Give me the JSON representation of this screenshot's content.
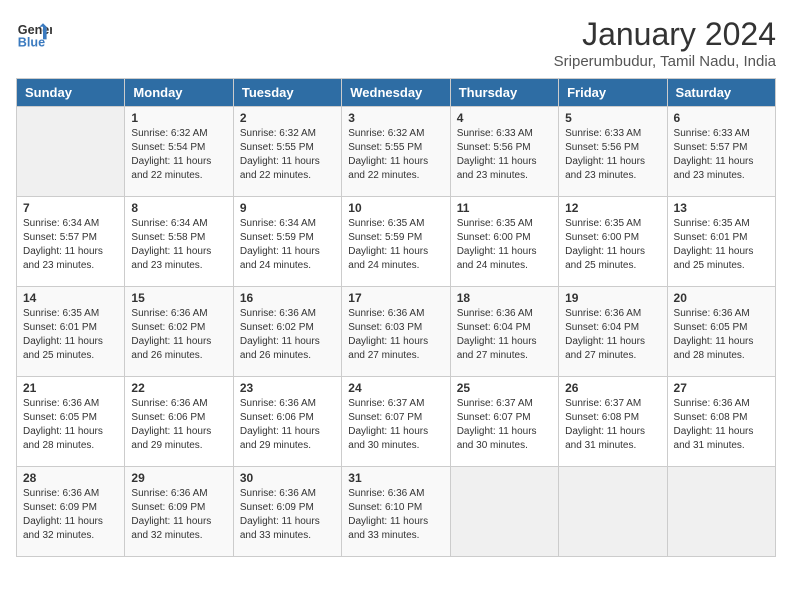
{
  "header": {
    "logo_line1": "General",
    "logo_line2": "Blue",
    "title": "January 2024",
    "subtitle": "Sriperumbudur, Tamil Nadu, India"
  },
  "days_of_week": [
    "Sunday",
    "Monday",
    "Tuesday",
    "Wednesday",
    "Thursday",
    "Friday",
    "Saturday"
  ],
  "weeks": [
    [
      {
        "day": "",
        "info": ""
      },
      {
        "day": "1",
        "info": "Sunrise: 6:32 AM\nSunset: 5:54 PM\nDaylight: 11 hours\nand 22 minutes."
      },
      {
        "day": "2",
        "info": "Sunrise: 6:32 AM\nSunset: 5:55 PM\nDaylight: 11 hours\nand 22 minutes."
      },
      {
        "day": "3",
        "info": "Sunrise: 6:32 AM\nSunset: 5:55 PM\nDaylight: 11 hours\nand 22 minutes."
      },
      {
        "day": "4",
        "info": "Sunrise: 6:33 AM\nSunset: 5:56 PM\nDaylight: 11 hours\nand 23 minutes."
      },
      {
        "day": "5",
        "info": "Sunrise: 6:33 AM\nSunset: 5:56 PM\nDaylight: 11 hours\nand 23 minutes."
      },
      {
        "day": "6",
        "info": "Sunrise: 6:33 AM\nSunset: 5:57 PM\nDaylight: 11 hours\nand 23 minutes."
      }
    ],
    [
      {
        "day": "7",
        "info": "Sunrise: 6:34 AM\nSunset: 5:57 PM\nDaylight: 11 hours\nand 23 minutes."
      },
      {
        "day": "8",
        "info": "Sunrise: 6:34 AM\nSunset: 5:58 PM\nDaylight: 11 hours\nand 23 minutes."
      },
      {
        "day": "9",
        "info": "Sunrise: 6:34 AM\nSunset: 5:59 PM\nDaylight: 11 hours\nand 24 minutes."
      },
      {
        "day": "10",
        "info": "Sunrise: 6:35 AM\nSunset: 5:59 PM\nDaylight: 11 hours\nand 24 minutes."
      },
      {
        "day": "11",
        "info": "Sunrise: 6:35 AM\nSunset: 6:00 PM\nDaylight: 11 hours\nand 24 minutes."
      },
      {
        "day": "12",
        "info": "Sunrise: 6:35 AM\nSunset: 6:00 PM\nDaylight: 11 hours\nand 25 minutes."
      },
      {
        "day": "13",
        "info": "Sunrise: 6:35 AM\nSunset: 6:01 PM\nDaylight: 11 hours\nand 25 minutes."
      }
    ],
    [
      {
        "day": "14",
        "info": "Sunrise: 6:35 AM\nSunset: 6:01 PM\nDaylight: 11 hours\nand 25 minutes."
      },
      {
        "day": "15",
        "info": "Sunrise: 6:36 AM\nSunset: 6:02 PM\nDaylight: 11 hours\nand 26 minutes."
      },
      {
        "day": "16",
        "info": "Sunrise: 6:36 AM\nSunset: 6:02 PM\nDaylight: 11 hours\nand 26 minutes."
      },
      {
        "day": "17",
        "info": "Sunrise: 6:36 AM\nSunset: 6:03 PM\nDaylight: 11 hours\nand 27 minutes."
      },
      {
        "day": "18",
        "info": "Sunrise: 6:36 AM\nSunset: 6:04 PM\nDaylight: 11 hours\nand 27 minutes."
      },
      {
        "day": "19",
        "info": "Sunrise: 6:36 AM\nSunset: 6:04 PM\nDaylight: 11 hours\nand 27 minutes."
      },
      {
        "day": "20",
        "info": "Sunrise: 6:36 AM\nSunset: 6:05 PM\nDaylight: 11 hours\nand 28 minutes."
      }
    ],
    [
      {
        "day": "21",
        "info": "Sunrise: 6:36 AM\nSunset: 6:05 PM\nDaylight: 11 hours\nand 28 minutes."
      },
      {
        "day": "22",
        "info": "Sunrise: 6:36 AM\nSunset: 6:06 PM\nDaylight: 11 hours\nand 29 minutes."
      },
      {
        "day": "23",
        "info": "Sunrise: 6:36 AM\nSunset: 6:06 PM\nDaylight: 11 hours\nand 29 minutes."
      },
      {
        "day": "24",
        "info": "Sunrise: 6:37 AM\nSunset: 6:07 PM\nDaylight: 11 hours\nand 30 minutes."
      },
      {
        "day": "25",
        "info": "Sunrise: 6:37 AM\nSunset: 6:07 PM\nDaylight: 11 hours\nand 30 minutes."
      },
      {
        "day": "26",
        "info": "Sunrise: 6:37 AM\nSunset: 6:08 PM\nDaylight: 11 hours\nand 31 minutes."
      },
      {
        "day": "27",
        "info": "Sunrise: 6:36 AM\nSunset: 6:08 PM\nDaylight: 11 hours\nand 31 minutes."
      }
    ],
    [
      {
        "day": "28",
        "info": "Sunrise: 6:36 AM\nSunset: 6:09 PM\nDaylight: 11 hours\nand 32 minutes."
      },
      {
        "day": "29",
        "info": "Sunrise: 6:36 AM\nSunset: 6:09 PM\nDaylight: 11 hours\nand 32 minutes."
      },
      {
        "day": "30",
        "info": "Sunrise: 6:36 AM\nSunset: 6:09 PM\nDaylight: 11 hours\nand 33 minutes."
      },
      {
        "day": "31",
        "info": "Sunrise: 6:36 AM\nSunset: 6:10 PM\nDaylight: 11 hours\nand 33 minutes."
      },
      {
        "day": "",
        "info": ""
      },
      {
        "day": "",
        "info": ""
      },
      {
        "day": "",
        "info": ""
      }
    ]
  ]
}
